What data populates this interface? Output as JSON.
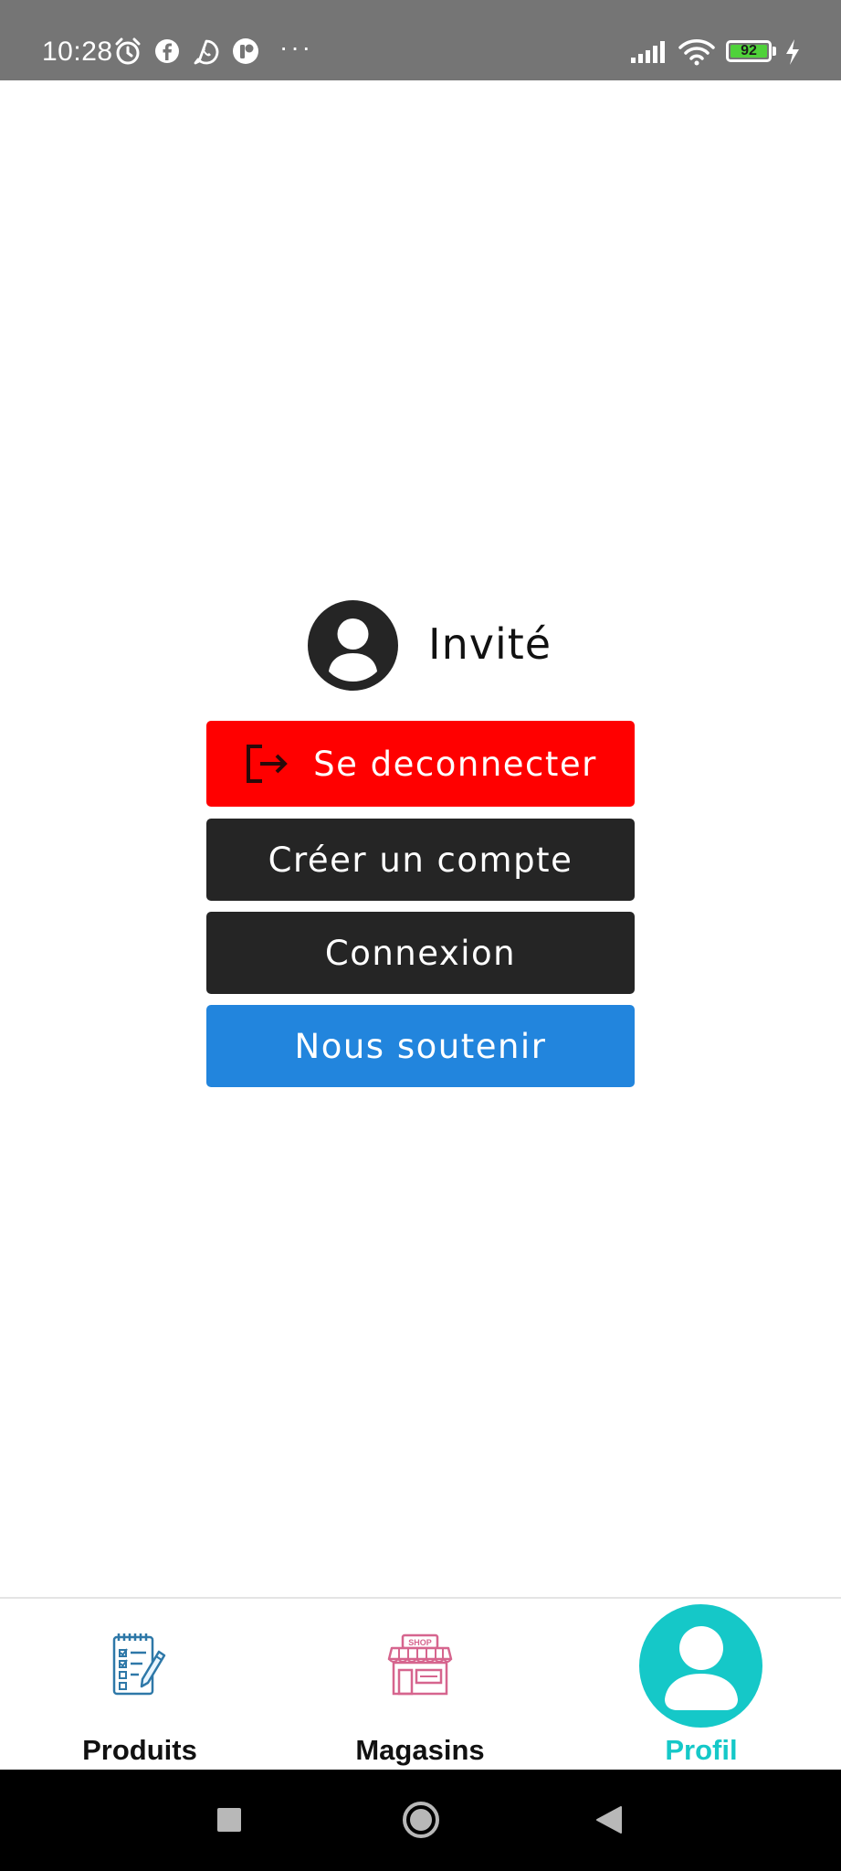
{
  "status_bar": {
    "time": "10:28",
    "battery_level": "92",
    "more_indicator": "···",
    "icons": [
      "alarm-icon",
      "facebook-icon",
      "whatsapp-icon",
      "app-notification-icon",
      "signal-icon",
      "wifi-icon",
      "battery-icon",
      "charging-icon"
    ]
  },
  "profile": {
    "username": "Invité",
    "avatar_icon": "user-circle-icon"
  },
  "buttons": {
    "logout": "Se deconnecter",
    "create_account": "Créer un compte",
    "login": "Connexion",
    "support": "Nous soutenir"
  },
  "colors": {
    "logout": "#ff0000",
    "dark_button": "#252525",
    "support": "#2285dd",
    "active_tab": "#15c8c8"
  },
  "bottom_nav": {
    "items": [
      {
        "label": "Produits",
        "icon": "checklist-icon"
      },
      {
        "label": "Magasins",
        "icon": "shop-icon",
        "icon_text": "SHOP"
      },
      {
        "label": "Profil",
        "icon": "user-icon",
        "active": true
      }
    ]
  },
  "system_nav": {
    "items": [
      "recents-button",
      "home-button",
      "back-button"
    ]
  }
}
